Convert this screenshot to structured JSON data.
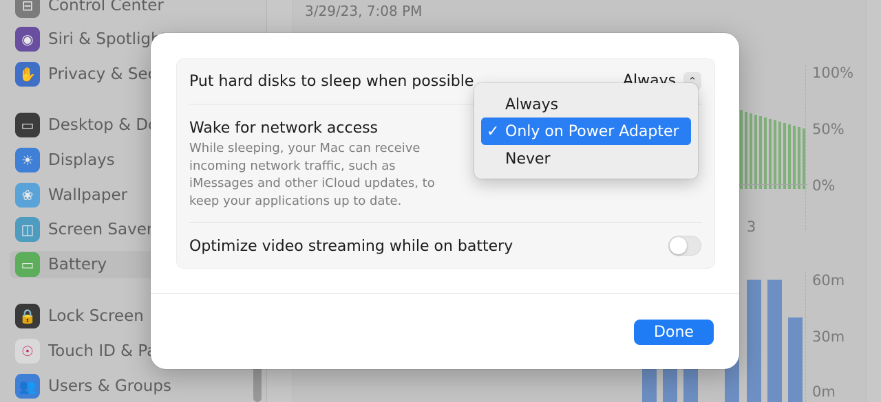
{
  "sidebar": {
    "items": [
      {
        "label": "Control Center",
        "icon": "control-center-icon",
        "color": "#7b7b7b",
        "glyph": "⊟"
      },
      {
        "label": "Siri & Spotlight",
        "icon": "siri-icon",
        "color": "#6a4fa0",
        "glyph": "◉"
      },
      {
        "label": "Privacy & Security",
        "icon": "hand-icon",
        "color": "#3f6fc6",
        "glyph": "✋"
      },
      {
        "label": "Desktop & Dock",
        "icon": "dock-icon",
        "color": "#3c3c3c",
        "glyph": "▭"
      },
      {
        "label": "Displays",
        "icon": "sun-icon",
        "color": "#3f7fd6",
        "glyph": "☀"
      },
      {
        "label": "Wallpaper",
        "icon": "flower-icon",
        "color": "#5aa3d8",
        "glyph": "❀"
      },
      {
        "label": "Screen Saver",
        "icon": "screen-saver-icon",
        "color": "#4e9cc0",
        "glyph": "◫"
      },
      {
        "label": "Battery",
        "icon": "battery-icon",
        "color": "#5cae5a",
        "glyph": "▭"
      },
      {
        "label": "Lock Screen",
        "icon": "lock-icon",
        "color": "#3a3a3a",
        "glyph": "🔒"
      },
      {
        "label": "Touch ID & Password",
        "icon": "fingerprint-icon",
        "color": "#d9d9d9",
        "glyph": "☉"
      },
      {
        "label": "Users & Groups",
        "icon": "users-icon",
        "color": "#3f7fd6",
        "glyph": "👥"
      }
    ],
    "selected": "Battery"
  },
  "main": {
    "timestamp": "3/29/23, 7:08 PM",
    "chart_level": {
      "labels": [
        "100%",
        "50%",
        "0%"
      ],
      "x_label": "3"
    },
    "chart_usage": {
      "labels": [
        "60m",
        "30m",
        "0m"
      ]
    }
  },
  "sheet": {
    "rows": [
      {
        "title": "Put hard disks to sleep when possible",
        "value": "Always"
      },
      {
        "title": "Wake for network access",
        "description": "While sleeping, your Mac can receive incoming network traffic, such as iMessages and other iCloud updates, to keep your applications up to date."
      },
      {
        "title": "Optimize video streaming while on battery",
        "toggle": false
      }
    ],
    "done_label": "Done"
  },
  "menu": {
    "options": [
      "Always",
      "Only on Power Adapter",
      "Never"
    ],
    "selected": "Only on Power Adapter",
    "check": "✓"
  },
  "colors": {
    "accent": "#1f7cf5",
    "menu_highlight": "#2a7ef4",
    "battery_green": "#7fb079",
    "usage_blue": "#6d8fc3"
  }
}
